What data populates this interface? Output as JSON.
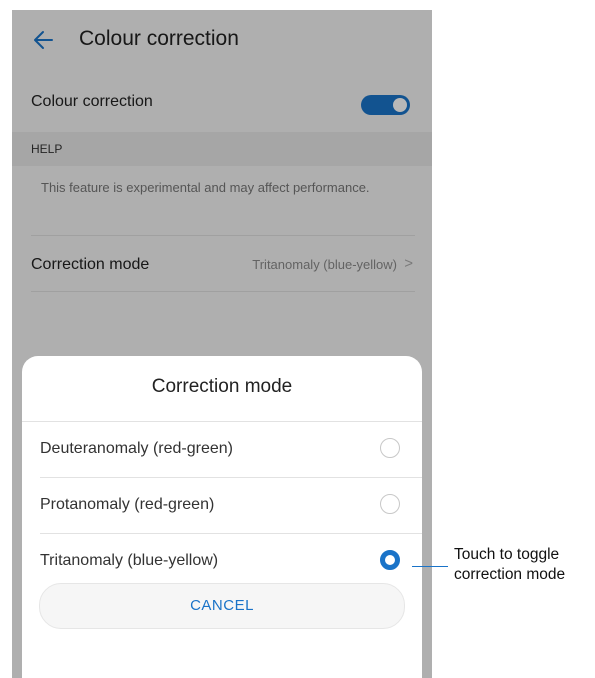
{
  "screen": {
    "title": "Colour correction",
    "toggle_row": {
      "label": "Colour correction",
      "enabled": true
    },
    "help_header": "HELP",
    "help_text": "This feature is experimental and may affect performance.",
    "mode_row": {
      "label": "Correction mode",
      "value": "Tritanomaly (blue-yellow)",
      "chevron": ">"
    }
  },
  "dialog": {
    "title": "Correction mode",
    "options": [
      {
        "label": "Deuteranomaly (red-green)",
        "selected": false
      },
      {
        "label": "Protanomaly (red-green)",
        "selected": false
      },
      {
        "label": "Tritanomaly (blue-yellow)",
        "selected": true
      }
    ],
    "cancel_label": "CANCEL"
  },
  "annotation": {
    "line1": "Touch to toggle",
    "line2": "correction mode"
  },
  "colors": {
    "accent": "#1a73c8",
    "background": "#f3f3f3",
    "dialog": "#ffffff"
  },
  "icons": {
    "back": "arrow-left-icon",
    "chevron": "chevron-right-icon"
  }
}
